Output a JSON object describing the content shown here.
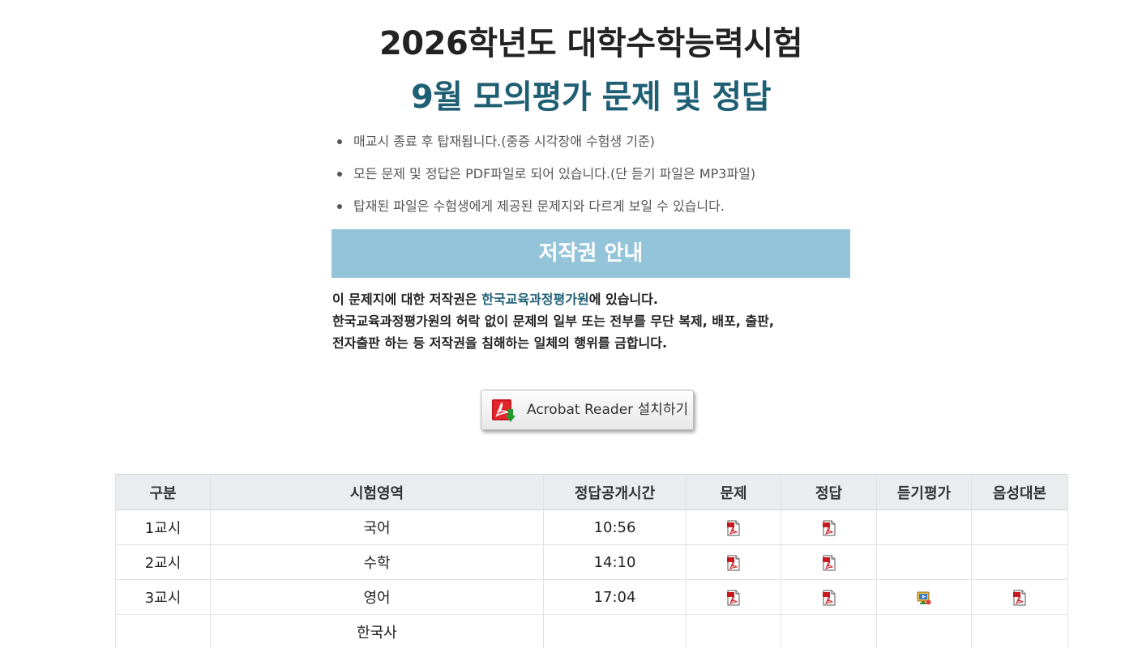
{
  "header": {
    "title_line1": "2026학년도 대학수학능력시험",
    "title_line2": "9월 모의평가 문제 및 정답"
  },
  "notes": [
    "매교시 종료 후 탑재됩니다.(중증 시각장애 수험생 기준)",
    "모든 문제 및 정답은 PDF파일로 되어 있습니다.(단 듣기 파일은 MP3파일)",
    "탑재된 파일은 수험생에게 제공된 문제지와 다르게 보일 수 있습니다."
  ],
  "copyright": {
    "heading": "저작권 안내",
    "line1_prefix": "이 문제지에 대한 저작권은 ",
    "line1_org": "한국교육과정평가원",
    "line1_suffix": "에 있습니다.",
    "line2": "한국교육과정평가원의 허락 없이 문제의 일부 또는 전부를 무단 복제, 배포, 출판,",
    "line3": "전자출판 하는 등 저작권을 침해하는 일체의 행위를 금합니다."
  },
  "acrobat": {
    "label": "Acrobat Reader 설치하기",
    "icon": "adobe-pdf-download-icon"
  },
  "table": {
    "headers": [
      "구분",
      "시험영역",
      "정답공개시간",
      "문제",
      "정답",
      "듣기평가",
      "음성대본"
    ],
    "rows": [
      {
        "period": "1교시",
        "subject": "국어",
        "time": "10:56",
        "problem": "pdf-icon",
        "answer": "pdf-icon",
        "listening": "",
        "script": ""
      },
      {
        "period": "2교시",
        "subject": "수학",
        "time": "14:10",
        "problem": "pdf-icon",
        "answer": "pdf-icon",
        "listening": "",
        "script": ""
      },
      {
        "period": "3교시",
        "subject": "영어",
        "time": "17:04",
        "problem": "pdf-icon",
        "answer": "pdf-icon",
        "listening": "media-player-icon",
        "script": "pdf-icon"
      },
      {
        "period": "",
        "subject": "한국사",
        "time": "",
        "problem": "",
        "answer": "",
        "listening": "",
        "script": ""
      }
    ]
  },
  "colors": {
    "title_accent": "#1f5f74",
    "banner_bg": "#93c4da",
    "table_header_bg": "#e9edf0"
  }
}
